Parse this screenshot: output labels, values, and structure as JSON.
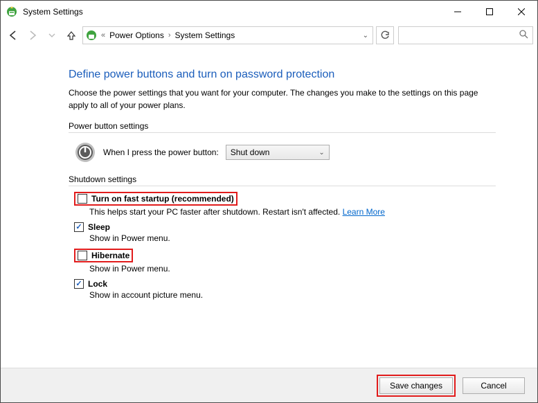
{
  "window": {
    "title": "System Settings"
  },
  "breadcrumb": {
    "back_label": "«",
    "item1": "Power Options",
    "item2": "System Settings"
  },
  "main": {
    "heading": "Define power buttons and turn on password protection",
    "description": "Choose the power settings that you want for your computer. The changes you make to the settings on this page apply to all of your power plans.",
    "power_section_label": "Power button settings",
    "power_button_label": "When I press the power button:",
    "power_button_value": "Shut down",
    "shutdown_section_label": "Shutdown settings",
    "items": {
      "fast_startup": {
        "label": "Turn on fast startup (recommended)",
        "sub": "This helps start your PC faster after shutdown. Restart isn't affected. ",
        "link": "Learn More",
        "checked": false
      },
      "sleep": {
        "label": "Sleep",
        "sub": "Show in Power menu.",
        "checked": true
      },
      "hibernate": {
        "label": "Hibernate",
        "sub": "Show in Power menu.",
        "checked": false
      },
      "lock": {
        "label": "Lock",
        "sub": "Show in account picture menu.",
        "checked": true
      }
    }
  },
  "footer": {
    "save": "Save changes",
    "cancel": "Cancel"
  }
}
